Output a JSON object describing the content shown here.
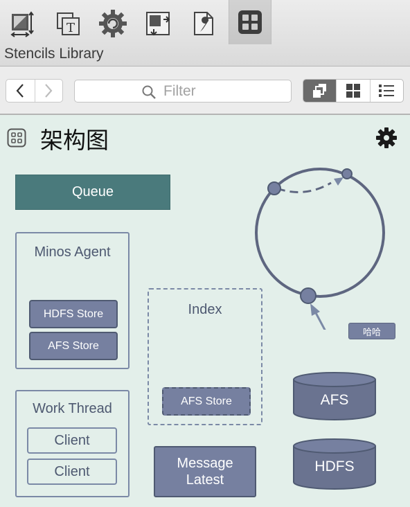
{
  "inspector": {
    "title": "Stencils Library",
    "tabs": [
      {
        "icon": "canvas-size-icon"
      },
      {
        "icon": "text-icon"
      },
      {
        "icon": "gear-arrow-icon"
      },
      {
        "icon": "layout-icon"
      },
      {
        "icon": "document-wrench-icon"
      },
      {
        "icon": "stencil-grid-icon",
        "active": true
      }
    ]
  },
  "toolbar": {
    "back_icon": "chevron-left-icon",
    "forward_icon": "chevron-right-icon",
    "filter_placeholder": "Filter",
    "view_modes": [
      "stacked-squares-icon",
      "grid-icon",
      "list-icon"
    ],
    "active_view": 0
  },
  "stencil": {
    "title": "架构图",
    "icon": "grid-icon",
    "settings_icon": "gear-icon"
  },
  "diagram": {
    "queue": "Queue",
    "minos_agent": {
      "label": "Minos Agent",
      "items": [
        "HDFS Store",
        "AFS Store"
      ]
    },
    "work_thread": {
      "label": "Work Thread",
      "items": [
        "Client",
        "Client"
      ]
    },
    "index": {
      "label": "Index",
      "item": "AFS Store"
    },
    "message": {
      "line1": "Message",
      "line2": "Latest"
    },
    "callout": "哈哈",
    "cylinders": [
      "AFS",
      "HDFS"
    ]
  },
  "colors": {
    "background": "#e3efea",
    "queue_fill": "#4a7a7c",
    "shape_fill": "#7680a0",
    "outline": "#7b89a6",
    "ring": "#5e6680"
  }
}
